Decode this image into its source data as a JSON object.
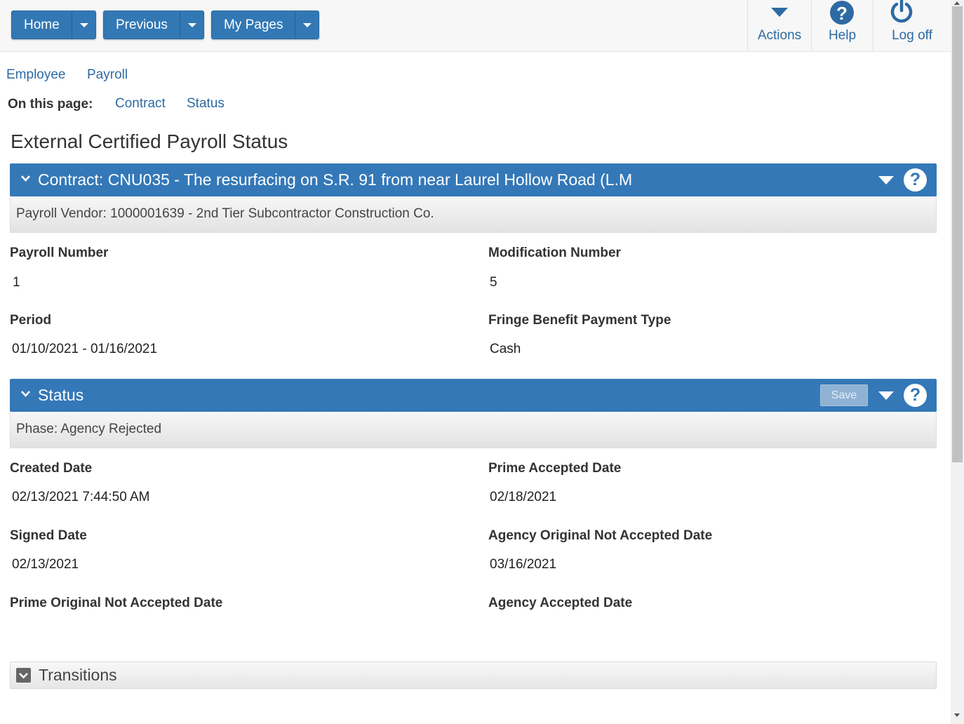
{
  "topbar": {
    "home_label": "Home",
    "previous_label": "Previous",
    "mypages_label": "My Pages",
    "actions_label": "Actions",
    "help_label": "Help",
    "logoff_label": "Log off"
  },
  "breadcrumb": {
    "employee": "Employee",
    "payroll": "Payroll"
  },
  "onpage": {
    "label": "On this page:",
    "contract": "Contract",
    "status": "Status"
  },
  "page_title": "External Certified Payroll Status",
  "contract_panel": {
    "title": "Contract: CNU035 - The resurfacing on S.R. 91 from near Laurel Hollow Road (L.M",
    "subtitle": "Payroll Vendor: 1000001639 - 2nd Tier Subcontractor Construction Co.",
    "help_glyph": "?"
  },
  "contract_fields": {
    "payroll_number_label": "Payroll Number",
    "payroll_number": "1",
    "modification_number_label": "Modification Number",
    "modification_number": "5",
    "period_label": "Period",
    "period": "01/10/2021 - 01/16/2021",
    "fringe_label": "Fringe Benefit Payment Type",
    "fringe": "Cash"
  },
  "status_panel": {
    "title": "Status",
    "save_label": "Save",
    "subtitle": "Phase: Agency Rejected",
    "help_glyph": "?"
  },
  "status_fields": {
    "created_date_label": "Created Date",
    "created_date": "02/13/2021 7:44:50 AM",
    "prime_accepted_label": "Prime Accepted Date",
    "prime_accepted": "02/18/2021",
    "signed_date_label": "Signed Date",
    "signed_date": "02/13/2021",
    "agency_orig_not_accepted_label": "Agency Original Not Accepted Date",
    "agency_orig_not_accepted": "03/16/2021",
    "prime_orig_not_accepted_label": "Prime Original Not Accepted Date",
    "agency_accepted_label": "Agency Accepted Date"
  },
  "transitions": {
    "title": "Transitions"
  },
  "colors": {
    "accent": "#3478b8",
    "link": "#2d6aa3"
  },
  "icons": [
    "caret-down-icon",
    "help-icon",
    "power-icon",
    "chevron-down-icon",
    "collapse-box-icon"
  ]
}
